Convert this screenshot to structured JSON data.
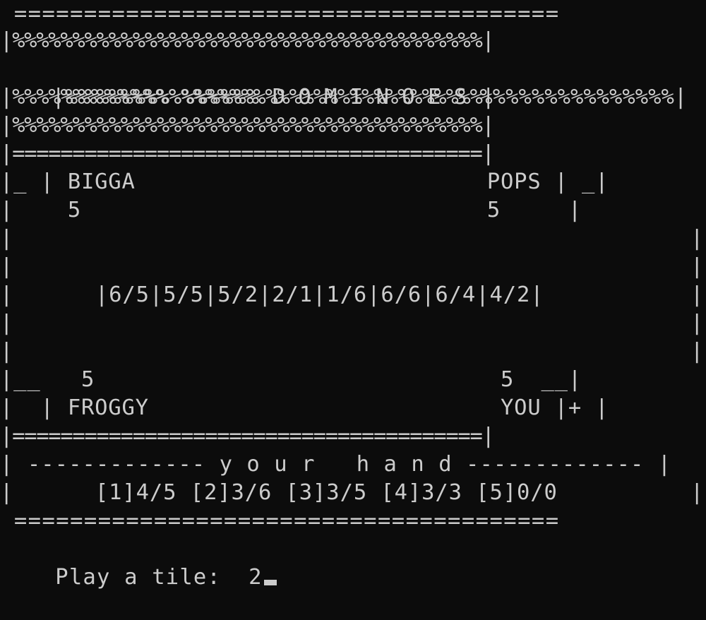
{
  "banner": {
    "top_rule": " =======================================",
    "pct_row_1": "|%%%%%%%%%%%%%%%%%%%%%%%%%%%%%%%%%%%%%%%|",
    "title_row": "|%%%%%%%%%%%%%%% D O M I N O E S %%%%%%%%%%%%%%%|",
    "pct_row_2": "|%%%%%%%%%%%%%%%%%%%%%%%%%%%%%%%%%%%%%%%|",
    "pct_row_3": "|%%%%%%%%%%%%%%%%%%%%%%%%%%%%%%%%%%%%%%%|",
    "mid_rule": "|=======================================|"
  },
  "players": {
    "top_row": "|_ | BIGGA                          POPS | _|",
    "top_counts": "|    5                              5     |",
    "bottom_counts": "|__   5                              5  __|",
    "bottom_row": "|  | FROGGY                          YOU |+ |",
    "names": [
      "BIGGA",
      "POPS",
      "FROGGY",
      "YOU"
    ],
    "tile_counts": [
      5,
      5,
      5,
      5
    ]
  },
  "board": {
    "blank_1": "|",
    "blank_1_right": "|",
    "blank_2": "|",
    "blank_2_right": "|",
    "chain_row": "|      |6/5|5/5|5/2|2/1|1/6|6/6|6/4|4/2|",
    "chain_right": "|",
    "blank_3": "|",
    "blank_3_right": "|",
    "blank_4": "|",
    "blank_4_right": "|",
    "chain": [
      "6/5",
      "5/5",
      "5/2",
      "2/1",
      "1/6",
      "6/6",
      "6/4",
      "4/2"
    ]
  },
  "hand": {
    "rule": "|=======================================|",
    "header": "| ------------- y o u r   h a n d ------------- |",
    "tiles_row": "|      [1]4/5 [2]3/6 [3]3/5 [4]3/3 [5]0/0",
    "tiles_right": "|",
    "bottom_rule": " =======================================",
    "tiles": [
      "[1]4/5",
      "[2]3/6",
      "[3]3/5",
      "[4]3/3",
      "[5]0/0"
    ]
  },
  "prompt": {
    "label": "Play a tile:",
    "input_value": "2"
  },
  "colors": {
    "background": "#0c0c0c",
    "foreground": "#cccccc"
  }
}
